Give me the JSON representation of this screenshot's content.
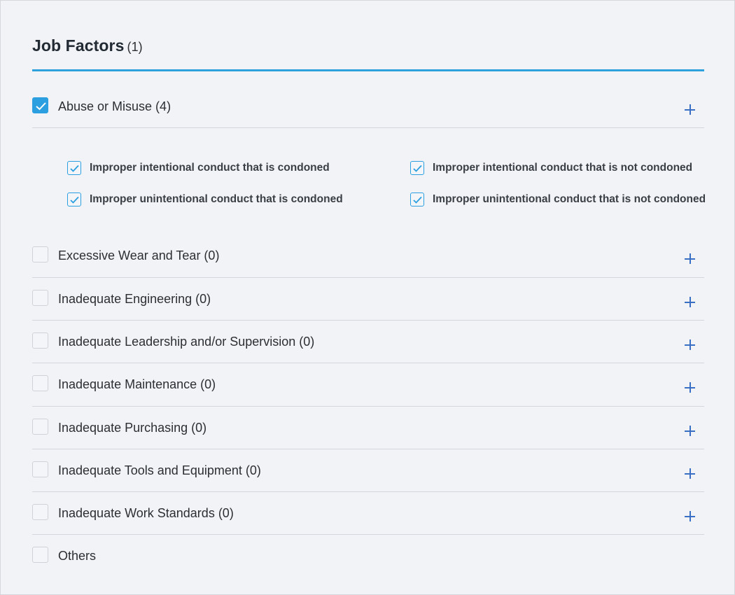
{
  "section": {
    "title": "Job Factors",
    "count": "(1)"
  },
  "factors": [
    {
      "label": "Abuse or Misuse (4)",
      "checked": true,
      "expandable": true
    },
    {
      "label": "Excessive Wear and Tear (0)",
      "checked": false,
      "expandable": true
    },
    {
      "label": "Inadequate Engineering (0)",
      "checked": false,
      "expandable": true
    },
    {
      "label": "Inadequate Leadership and/or Supervision (0)",
      "checked": false,
      "expandable": true
    },
    {
      "label": "Inadequate Maintenance (0)",
      "checked": false,
      "expandable": true
    },
    {
      "label": "Inadequate Purchasing (0)",
      "checked": false,
      "expandable": true
    },
    {
      "label": "Inadequate Tools and Equipment (0)",
      "checked": false,
      "expandable": true
    },
    {
      "label": "Inadequate Work Standards (0)",
      "checked": false,
      "expandable": true
    },
    {
      "label": "Others",
      "checked": false,
      "expandable": false
    }
  ],
  "abuse_subfactors": [
    {
      "label": "Improper intentional conduct that is condoned",
      "checked": true
    },
    {
      "label": "Improper intentional conduct that is not condoned",
      "checked": true
    },
    {
      "label": "Improper unintentional conduct that is condoned",
      "checked": true
    },
    {
      "label": "Improper unintentional conduct that is not condoned",
      "checked": true
    }
  ],
  "icons": {
    "check": "check-icon",
    "expand": "plus-icon"
  },
  "colors": {
    "accent": "#2b9fe0",
    "plus": "#3a6fc4",
    "divider": "#d3d6dc",
    "background": "#f2f3f7"
  }
}
